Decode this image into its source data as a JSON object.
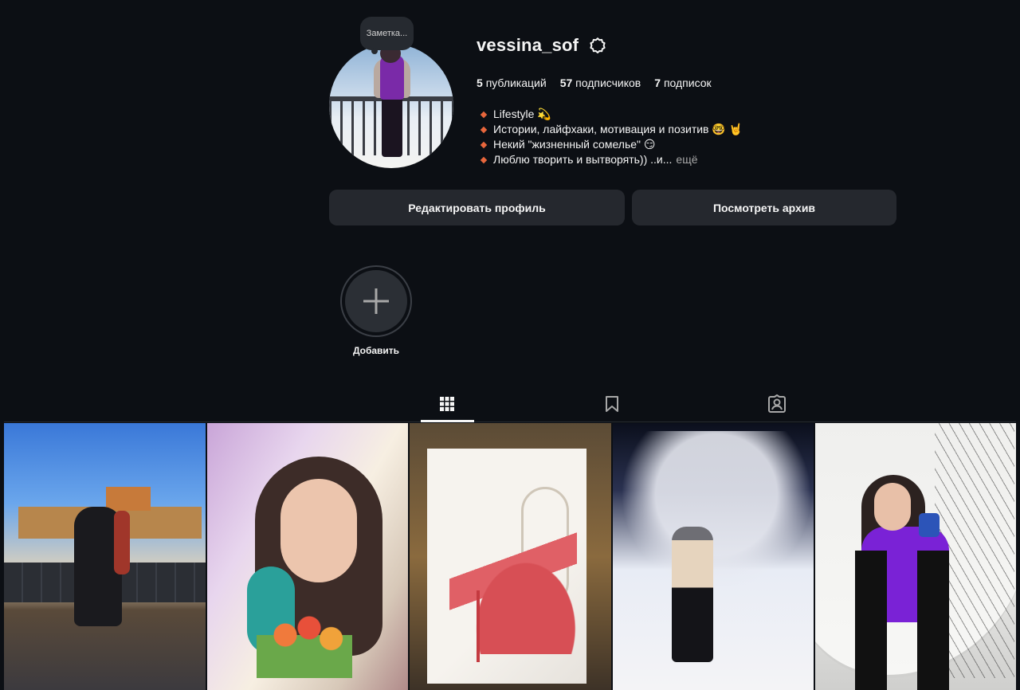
{
  "profile": {
    "note": "Заметка...",
    "username": "vessina_sof",
    "stats": {
      "posts_count": "5",
      "posts_label": "публикаций",
      "followers_count": "57",
      "followers_label": "подписчиков",
      "following_count": "7",
      "following_label": "подписок"
    },
    "bio": [
      "Lifestyle 💫",
      "Истории, лайфхаки, мотивация и позитив 🤓 🤘",
      "Некий \"жизненный сомелье\" 😏",
      "Люблю творить и вытворять)) ..и..."
    ],
    "bio_more": "ещё"
  },
  "actions": {
    "edit_profile": "Редактировать профиль",
    "view_archive": "Посмотреть архив"
  },
  "highlights": {
    "add_label": "Добавить"
  },
  "tabs": [
    {
      "name": "posts",
      "icon": "grid-icon",
      "active": true
    },
    {
      "name": "saved",
      "icon": "bookmark-icon",
      "active": false
    },
    {
      "name": "tagged",
      "icon": "tagged-icon",
      "active": false
    }
  ],
  "posts": [
    {
      "icon": "photo-pier"
    },
    {
      "icon": "photo-tulips"
    },
    {
      "icon": "photo-shoe-drawing"
    },
    {
      "icon": "photo-snow-night"
    },
    {
      "icon": "photo-mirror-selfie"
    }
  ],
  "colors": {
    "background": "#0c0f14",
    "button": "#25282e",
    "text": "#f5f5f5",
    "muted": "#a8a8a8",
    "bullet": "#e8663c"
  }
}
